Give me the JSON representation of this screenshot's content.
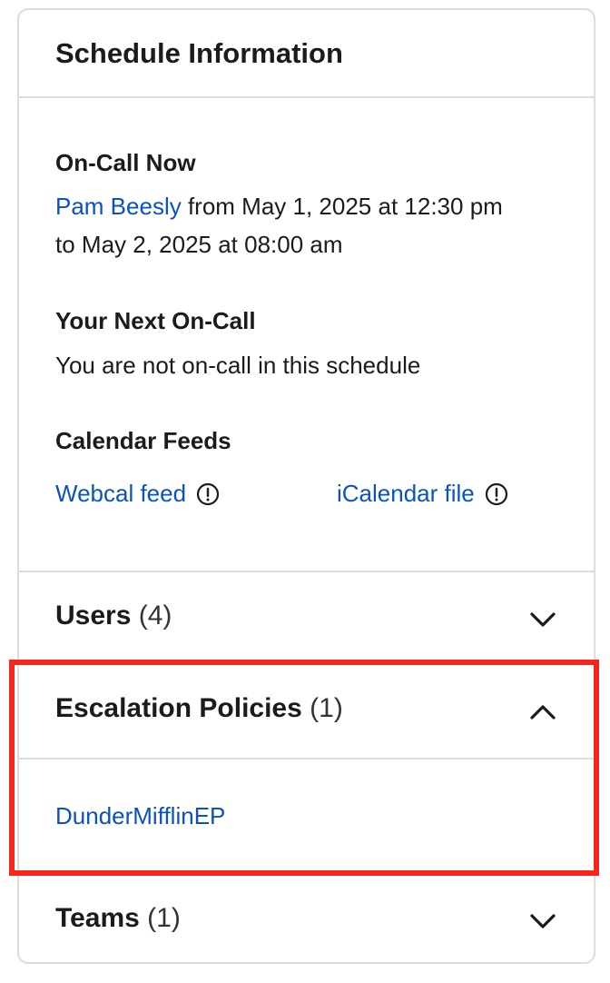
{
  "card": {
    "title": "Schedule Information"
  },
  "on_call_now": {
    "heading": "On-Call Now",
    "person": "Pam Beesly",
    "line1_rest": " from May 1, 2025 at 12:30 pm",
    "line2": "to May 2, 2025 at 08:00 am"
  },
  "next_on_call": {
    "heading": "Your Next On-Call",
    "text": "You are not on-call in this schedule"
  },
  "calendar_feeds": {
    "heading": "Calendar Feeds",
    "webcal_label": "Webcal feed",
    "icalendar_label": "iCalendar file"
  },
  "accordions": {
    "users": {
      "label": "Users",
      "count": "(4)",
      "expanded": false
    },
    "escalation_policies": {
      "label": "Escalation Policies",
      "count": "(1)",
      "expanded": true,
      "items": [
        "DunderMifflinEP"
      ]
    },
    "teams": {
      "label": "Teams",
      "count": "(1)",
      "expanded": false
    }
  },
  "colors": {
    "link": "#0a53be",
    "border": "#dcdcdc",
    "highlight": "#f5261b",
    "text": "#1b1b1b"
  },
  "icons": {
    "info": "info-circle-icon",
    "chevron_down": "chevron-down-icon",
    "chevron_up": "chevron-up-icon"
  }
}
